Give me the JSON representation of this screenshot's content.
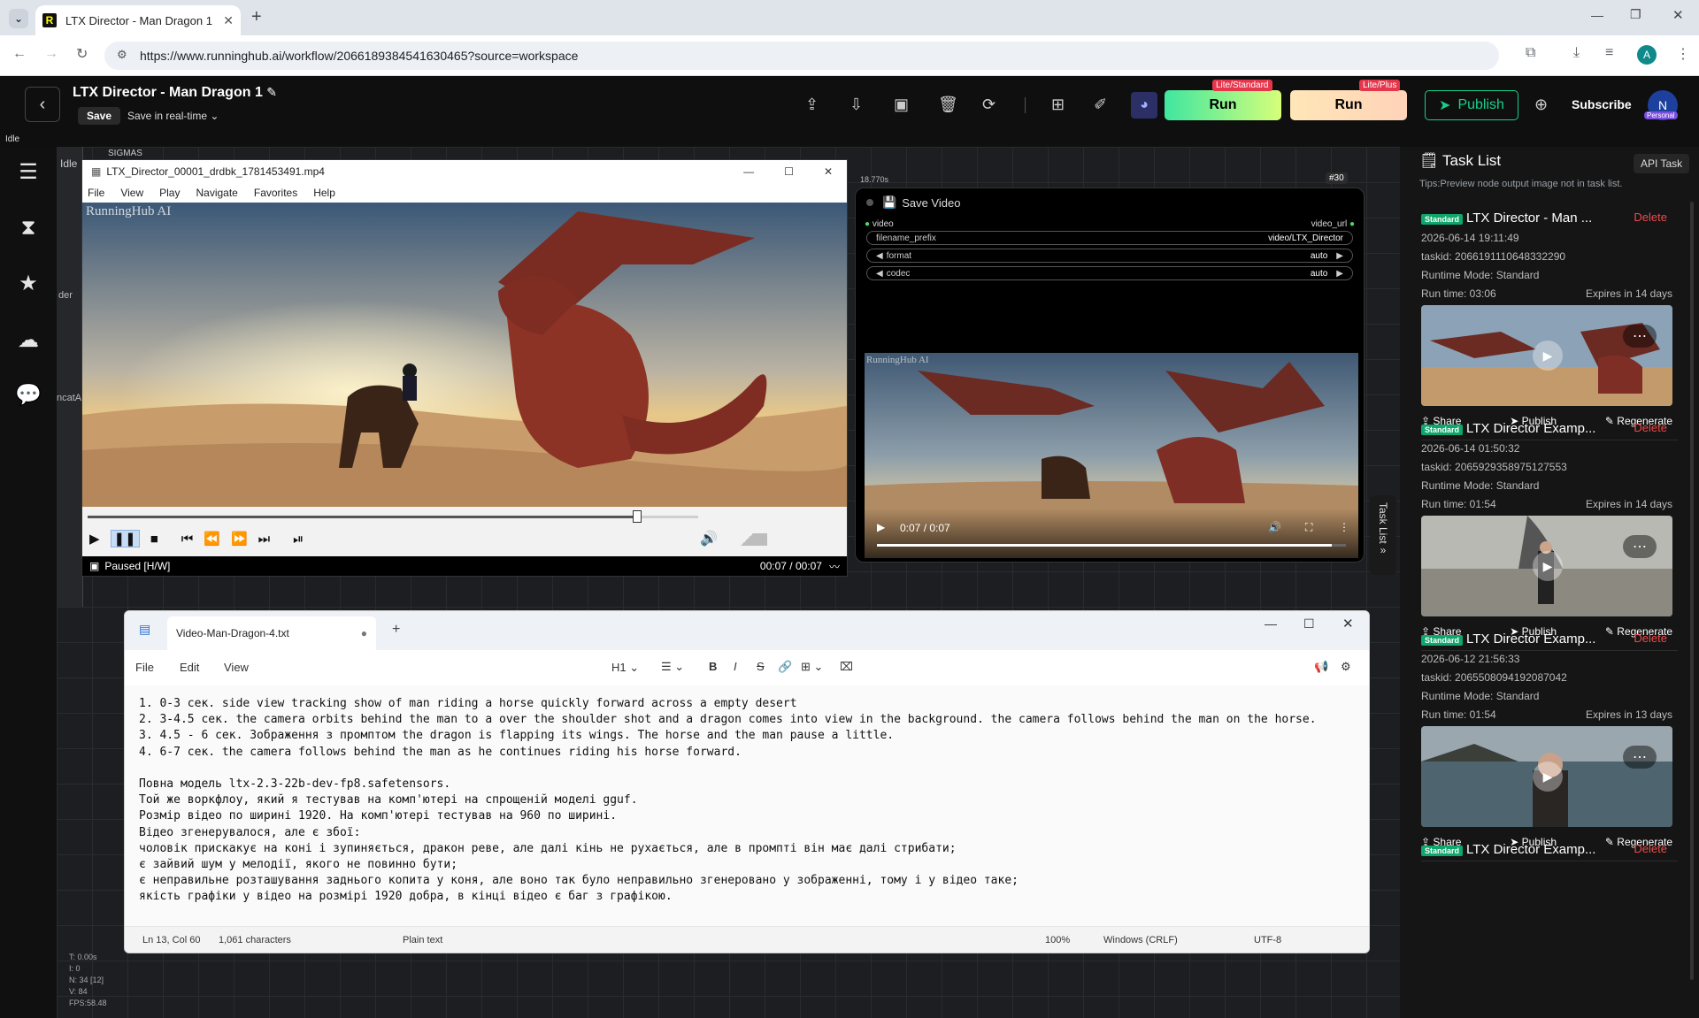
{
  "browser": {
    "tab_title": "LTX Director - Man Dragon 1",
    "url": "https://www.runninghub.ai/workflow/2066189384541630465?source=workspace",
    "profile_initial": "A"
  },
  "app": {
    "title": "LTX Director - Man Dragon 1",
    "save_label": "Save",
    "save_mode": "Save in real-time",
    "run_standard_label": "Run",
    "run_standard_tag": "Lite/Standard",
    "run_plus_label": "Run",
    "run_plus_tag": "Lite/Plus",
    "publish_label": "Publish",
    "subscribe_label": "Subscribe",
    "avatar_initial": "N",
    "avatar_tag": "Personal",
    "status": "Idle"
  },
  "canvas": {
    "node_fragments": [
      "Idle",
      "SIGMAS",
      "der",
      "ncatA"
    ],
    "stats": [
      "T: 0.00s",
      "I: 0",
      "N: 34 [12]",
      "V: 84",
      "FPS:58.48"
    ]
  },
  "media_player": {
    "title": "LTX_Director_00001_drdbk_1781453491.mp4",
    "menu": [
      "File",
      "View",
      "Play",
      "Navigate",
      "Favorites",
      "Help"
    ],
    "watermark": "RunningHub AI",
    "status": "Paused [H/W]",
    "time": "00:07 / 00:07",
    "progress": 0.9
  },
  "save_video_node": {
    "timing": "18.770s",
    "id_badge": "#30",
    "title": "Save Video",
    "input_label": "video",
    "output_label": "video_url",
    "fields": [
      {
        "name": "filename_prefix",
        "value": "video/LTX_Director"
      },
      {
        "name": "format",
        "value": "auto"
      },
      {
        "name": "codec",
        "value": "auto"
      }
    ],
    "watermark": "RunningHub AI",
    "time": "0:07 / 0:07",
    "progress": 0.97
  },
  "notepad": {
    "tab_title": "Video-Man-Dragon-4.txt",
    "menu": [
      "File",
      "Edit",
      "View"
    ],
    "heading_label": "H1",
    "lines": [
      "1. 0-3 сек. side view tracking show of man riding a horse quickly forward across a empty desert",
      "2. 3-4.5 сек. the camera orbits behind the man to a over the shoulder shot and a dragon comes into view in the background. the camera follows behind the man on the horse.",
      "3. 4.5 - 6 сек. Зображення з промптом the dragon is flapping its wings. The horse and the man pause a little.",
      "4. 6-7 сек. the camera follows behind the man as he continues riding his horse forward.",
      "",
      "Повна модель ltx-2.3-22b-dev-fp8.safetensors.",
      "Той же воркфлоу, який я тестував на комп'ютері на спрощеній моделі gguf.",
      "Розмір відео по ширині 1920. На комп'ютері тестував на 960 по ширині.",
      "Відео згенерувалося, але є збої:",
      "чоловік прискакує на коні і зупиняється, дракон реве, але далі кінь не рухається, але в промпті він має далі стрибати;",
      "є зайвий шум у мелодії, якого не повинно бути;",
      "є неправильне розташування заднього копита у коня, але воно так було неправильно згенеровано у зображенні, тому і у відео таке;",
      "якість графіки у відео на розмірі 1920 добра, в кінці відео є баг з графікою."
    ],
    "status": {
      "position": "Ln 13, Col 60",
      "chars": "1,061 characters",
      "type": "Plain text",
      "zoom": "100%",
      "eol": "Windows (CRLF)",
      "encoding": "UTF-8"
    }
  },
  "task_panel": {
    "title": "Task List",
    "api_task_label": "API Task",
    "tips": "Tips:Preview node output image not in task list.",
    "side_tab": "Task List",
    "tasks": [
      {
        "badge": "Standard",
        "title": "LTX Director - Man ...",
        "delete": "Delete",
        "date": "2026-06-14 19:11:49",
        "taskid": "taskid: 2066191110648332290",
        "mode": "Runtime Mode: Standard",
        "runtime": "Run time: 03:06",
        "expires": "Expires in 14 days",
        "thumb": "dragon"
      },
      {
        "badge": "Standard",
        "title": "LTX Director Examp...",
        "delete": "Delete",
        "date": "2026-06-14 01:50:32",
        "taskid": "taskid: 2065929358975127553",
        "mode": "Runtime Mode: Standard",
        "runtime": "Run time: 01:54",
        "expires": "Expires in 14 days",
        "thumb": "road"
      },
      {
        "badge": "Standard",
        "title": "LTX Director Examp...",
        "delete": "Delete",
        "date": "2026-06-12 21:56:33",
        "taskid": "taskid: 2065508094192087042",
        "mode": "Runtime Mode: Standard",
        "runtime": "Run time: 01:54",
        "expires": "Expires in 13 days",
        "thumb": "coast"
      },
      {
        "badge": "Standard",
        "title": "LTX Director Examp...",
        "delete": "Delete"
      }
    ],
    "share_label": "Share",
    "publish_label": "Publish",
    "regenerate_label": "Regenerate"
  }
}
